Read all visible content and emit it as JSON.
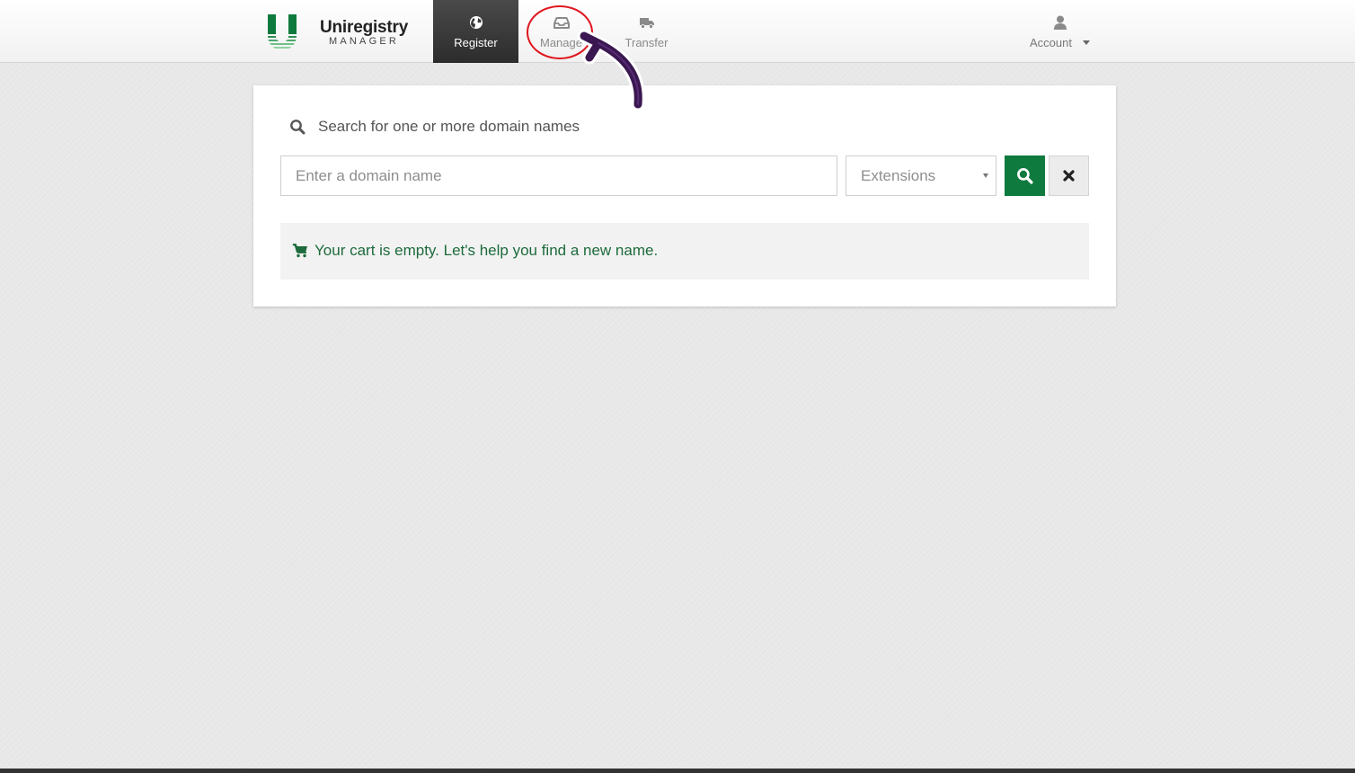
{
  "brand": {
    "name": "Uniregistry",
    "subtitle": "MANAGER"
  },
  "nav": {
    "items": [
      {
        "label": "Register",
        "icon": "globe-icon",
        "active": true
      },
      {
        "label": "Manage",
        "icon": "inbox-icon",
        "active": false
      },
      {
        "label": "Transfer",
        "icon": "truck-icon",
        "active": false
      }
    ],
    "account": {
      "label": "Account",
      "icon": "user-icon"
    }
  },
  "search": {
    "heading": "Search for one or more domain names",
    "placeholder": "Enter a domain name",
    "value": "",
    "extensions_label": "Extensions"
  },
  "cart": {
    "message": "Your cart is empty. Let's help you find a new name."
  },
  "colors": {
    "brand_green": "#0f7a3e",
    "cart_text": "#1d6b3c",
    "annotation_circle": "#e0141c",
    "annotation_arrow": "#3a1750",
    "active_nav": "#3a3a3a"
  }
}
